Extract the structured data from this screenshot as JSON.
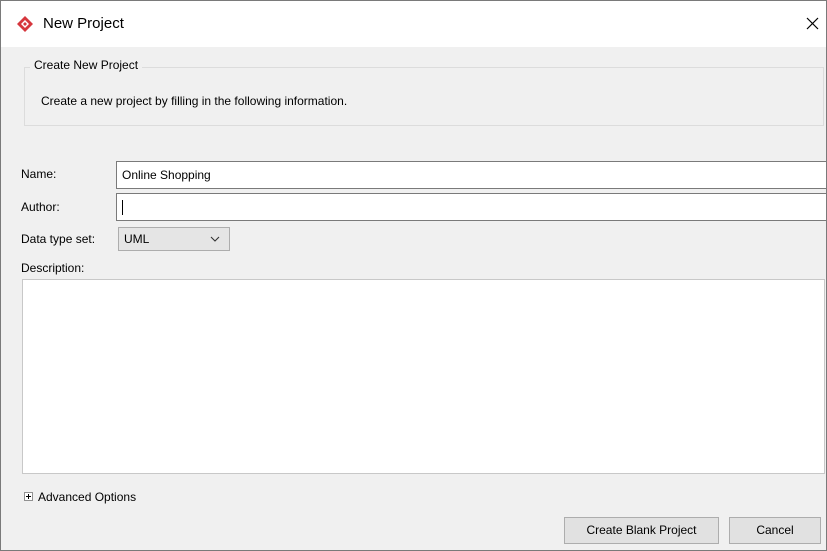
{
  "window": {
    "title": "New Project",
    "icon": "visual-paradigm-logo-icon",
    "close_icon": "close-icon"
  },
  "group": {
    "legend": "Create New Project",
    "description": "Create a new project by filling in the following information."
  },
  "form": {
    "name_label": "Name:",
    "name_value": "Online Shopping",
    "author_label": "Author:",
    "author_value": "",
    "data_type_label": "Data type set:",
    "data_type_value": "UML",
    "description_label": "Description:",
    "description_value": ""
  },
  "advanced": {
    "label": "Advanced Options",
    "icon": "expand-plus-icon"
  },
  "buttons": {
    "create_label": "Create Blank Project",
    "cancel_label": "Cancel"
  },
  "colors": {
    "brand": "#d6373d",
    "dialog_background": "#f0f0f0",
    "button_background": "#e1e1e1"
  }
}
